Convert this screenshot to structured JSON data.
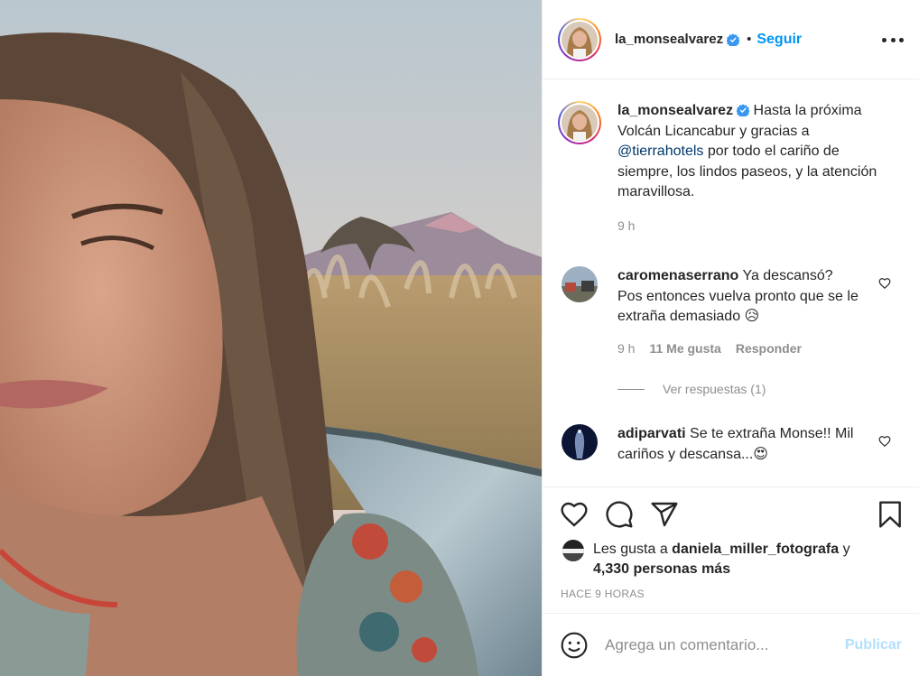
{
  "colors": {
    "accent_blue": "#0095f6",
    "verified_blue": "#3897f0",
    "text": "#262626",
    "muted": "#8e8e8e",
    "mention": "#00376b",
    "publish_disabled": "#b2dffc"
  },
  "header": {
    "username": "la_monsealvarez",
    "separator": "•",
    "follow_label": "Seguir"
  },
  "caption": {
    "username": "la_monsealvarez",
    "text_before": " Hasta la próxima Volcán Licancabur y gracias a ",
    "mention": "@tierrahotels",
    "text_after": " por todo el cariño de siempre, los lindos paseos, y la atención maravillosa.",
    "time": "9 h"
  },
  "comments": [
    {
      "username": "caromenaserrano",
      "text": " Ya descansó? Pos entonces vuelva pronto que se le extraña demasiado 😥",
      "time": "9 h",
      "likes": "11 Me gusta",
      "reply": "Responder",
      "view_replies": "Ver respuestas (1)"
    },
    {
      "username": "adiparvati",
      "text": " Se te extraña Monse!! Mil cariños y descansa...😍"
    }
  ],
  "likes": {
    "prefix": "Les gusta a ",
    "user": "daniela_miller_fotografa",
    "middle": " y",
    "count": "4,330 personas más"
  },
  "time_ago": "HACE 9 HORAS",
  "add_comment": {
    "placeholder": "Agrega un comentario...",
    "publish_label": "Publicar"
  },
  "icons": [
    "verified-icon",
    "more-options-icon",
    "heart-icon",
    "comment-icon",
    "share-icon",
    "bookmark-icon",
    "emoji-icon"
  ]
}
